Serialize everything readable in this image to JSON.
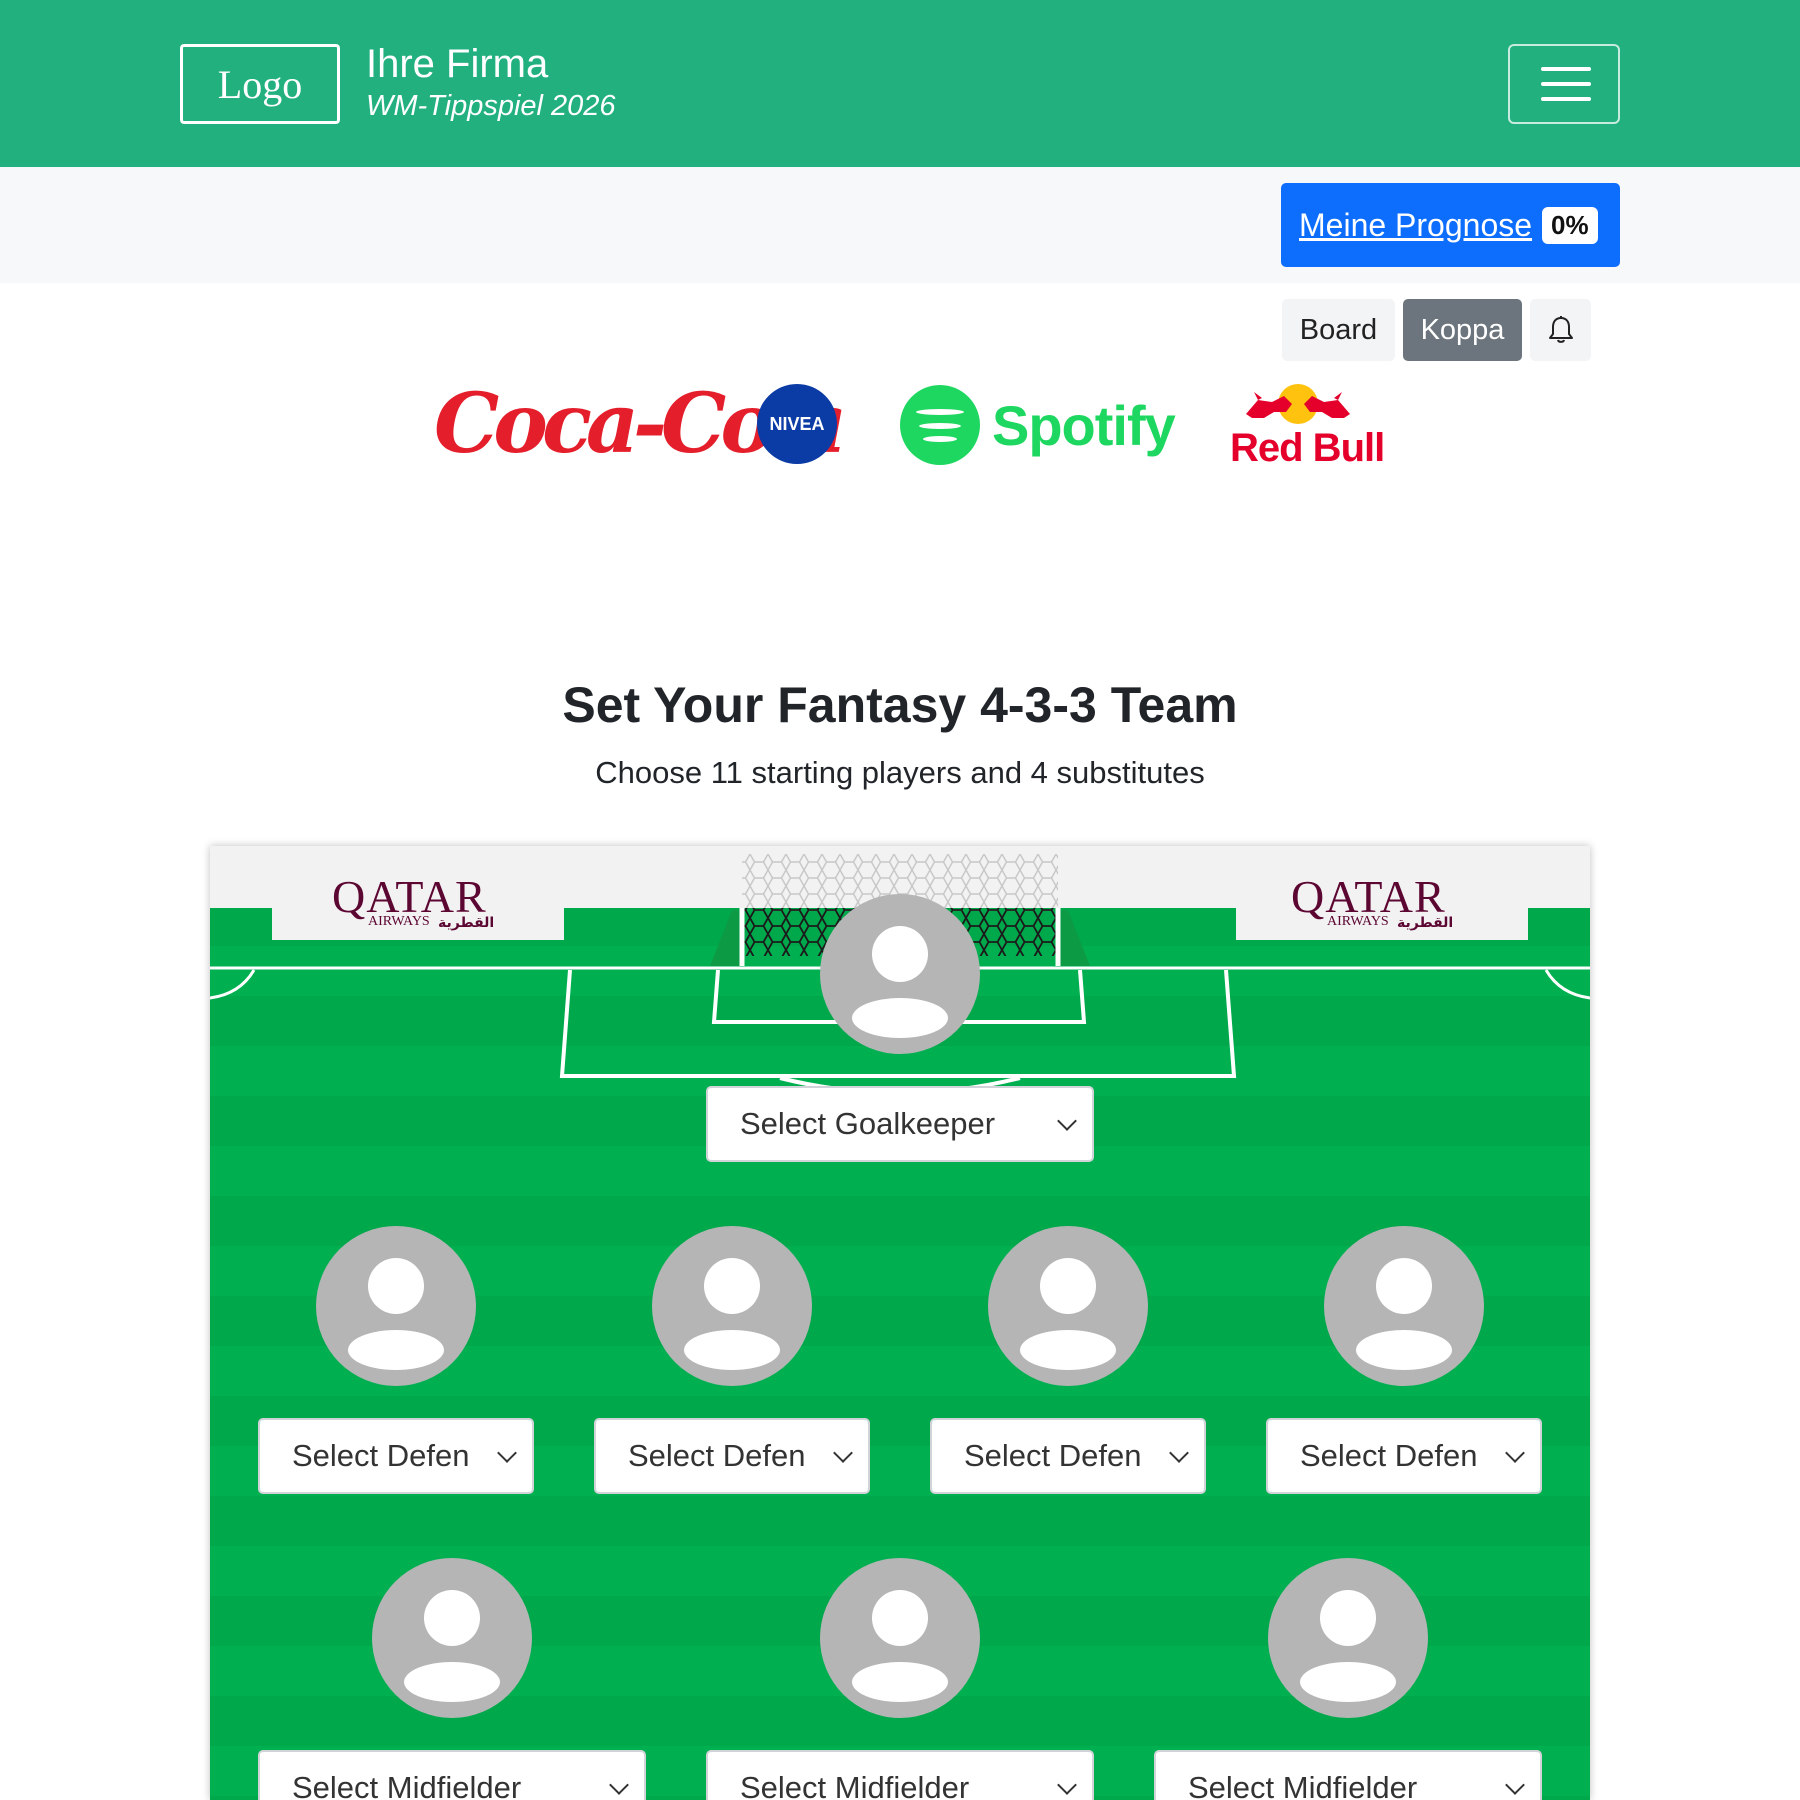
{
  "header": {
    "logo_label": "Logo",
    "company": "Ihre Firma",
    "subtitle": "WM-Tippspiel 2026",
    "menu_icon": "hamburger-icon"
  },
  "prognose": {
    "label": "Meine Prognose",
    "badge": "0%"
  },
  "tabs": {
    "board": "Board",
    "koppa": "Koppa",
    "active": "Koppa",
    "bell_icon": "bell-icon"
  },
  "sponsors": {
    "coca_cola": "Coca-Cola",
    "nivea": "NIVEA",
    "spotify": "Spotify",
    "redbull": "Red Bull"
  },
  "pitch_ads": {
    "left_brand": "QATAR",
    "left_sub": "AIRWAYS",
    "left_arabic": "القطرية",
    "right_brand": "QATAR",
    "right_sub": "AIRWAYS",
    "right_arabic": "القطرية"
  },
  "team": {
    "title": "Set Your Fantasy 4-3-3 Team",
    "subtitle": "Choose 11 starting players and 4 substitutes",
    "goalkeeper": {
      "placeholder": "Select Goalkeeper"
    },
    "defenders": [
      {
        "placeholder": "Select Defen"
      },
      {
        "placeholder": "Select Defen"
      },
      {
        "placeholder": "Select Defen"
      },
      {
        "placeholder": "Select Defen"
      }
    ],
    "midfielders": [
      {
        "placeholder": "Select Midfielder"
      },
      {
        "placeholder": "Select Midfielder"
      },
      {
        "placeholder": "Select Midfielder"
      }
    ]
  },
  "colors": {
    "header_green": "#22b07f",
    "primary_blue": "#0d6efd",
    "pitch_green": "#00b050",
    "avatar_gray": "#b5b5b5",
    "qatar_maroon": "#5c0632"
  }
}
